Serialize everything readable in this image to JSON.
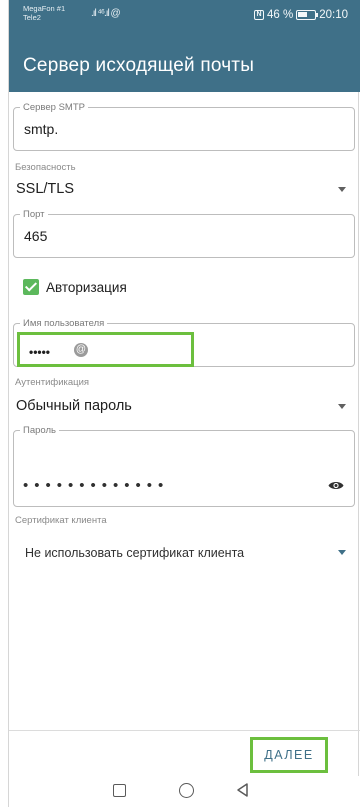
{
  "status_bar": {
    "carrier_1": "MegaFon #1",
    "carrier_2": "Tele2",
    "signal": ".ıl ⁴⁶.ıl @",
    "battery_percent": "46 %",
    "time": "20:10"
  },
  "app_bar": {
    "title": "Сервер исходящей почты"
  },
  "form": {
    "smtp_server": {
      "label": "Сервер SMTP",
      "value": "smtp."
    },
    "security": {
      "label": "Безопасность",
      "value": "SSL/TLS"
    },
    "port": {
      "label": "Порт",
      "value": "465"
    },
    "authorization": {
      "label": "Авторизация",
      "checked": true
    },
    "username": {
      "label": "Имя пользователя",
      "value": "•••••"
    },
    "authentication": {
      "label": "Аутентификация",
      "value": "Обычный пароль"
    },
    "password": {
      "label": "Пароль",
      "value": "•••••••••••••"
    },
    "client_certificate": {
      "label": "Сертификат клиента",
      "value": "Не использовать сертификат клиента"
    }
  },
  "footer": {
    "next_label": "ДАЛЕЕ"
  },
  "colors": {
    "app_bar": "#3f7088",
    "checkbox": "#5cb85c",
    "highlight": "#6cbf3e",
    "button_text": "#3f7088"
  },
  "icons": {
    "visibility": "eye-icon",
    "dropdown": "caret-down-icon",
    "nav": [
      "square-icon",
      "circle-icon",
      "back-triangle-icon"
    ]
  }
}
